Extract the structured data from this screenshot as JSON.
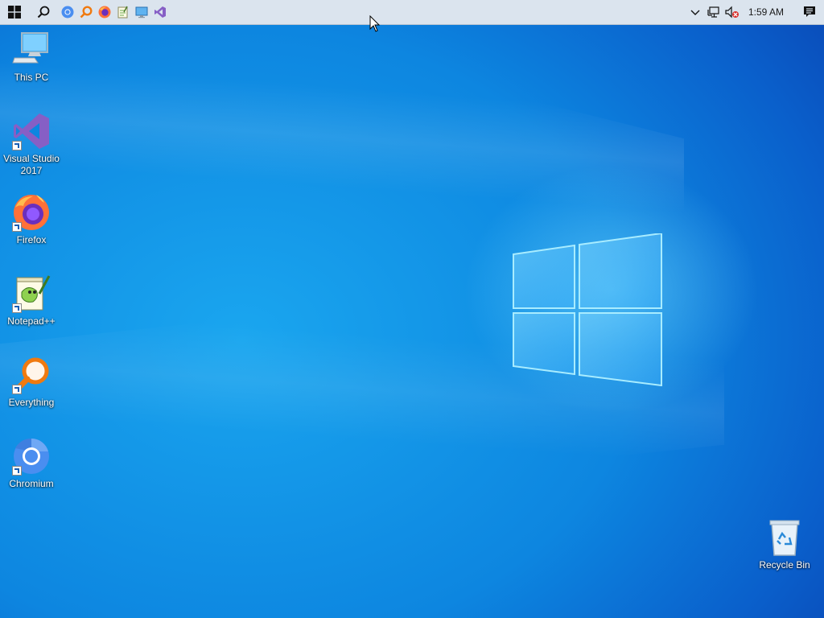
{
  "taskbar": {
    "start_icon": "windows-logo-icon",
    "search_icon": "search-icon",
    "pinned": [
      {
        "name": "chromium",
        "icon": "chromium-icon"
      },
      {
        "name": "everything",
        "icon": "everything-icon"
      },
      {
        "name": "firefox",
        "icon": "firefox-icon"
      },
      {
        "name": "notepad-plus-plus",
        "icon": "notepad-plus-plus-icon"
      },
      {
        "name": "remote-desktop",
        "icon": "monitor-icon"
      },
      {
        "name": "visual-studio",
        "icon": "visual-studio-icon"
      }
    ],
    "tray": {
      "overflow_icon": "chevron-up-icon",
      "network_icon": "network-icon",
      "volume_icon": "volume-muted-icon",
      "clock": "1:59 AM",
      "notification_icon": "action-center-icon"
    }
  },
  "desktop": {
    "icons": [
      {
        "label": "This PC",
        "icon": "computer-icon"
      },
      {
        "label": "Visual Studio 2017",
        "icon": "visual-studio-icon"
      },
      {
        "label": "Firefox",
        "icon": "firefox-icon"
      },
      {
        "label": "Notepad++",
        "icon": "notepad-plus-plus-icon"
      },
      {
        "label": "Everything",
        "icon": "everything-icon"
      },
      {
        "label": "Chromium",
        "icon": "chromium-icon"
      }
    ],
    "recycle_bin": {
      "label": "Recycle Bin",
      "icon": "recycle-bin-icon"
    }
  },
  "colors": {
    "wallpaper": "#0d86e0",
    "taskbar": "#dbe4ee"
  }
}
